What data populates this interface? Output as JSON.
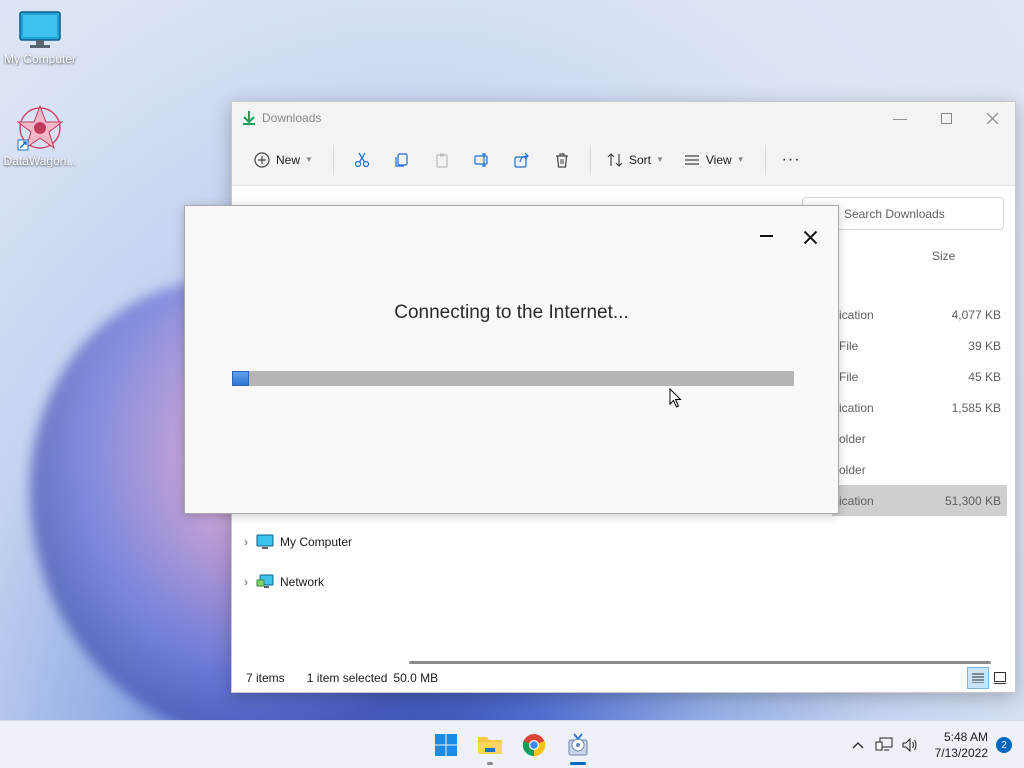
{
  "desktop": {
    "icons": [
      {
        "label": "My Computer"
      },
      {
        "label": "DataWagon..."
      }
    ]
  },
  "explorer": {
    "title": "Downloads",
    "toolbar": {
      "new_label": "New",
      "sort_label": "Sort",
      "view_label": "View",
      "more_label": "···"
    },
    "search_placeholder": "Search Downloads",
    "column_size": "Size",
    "rows": [
      {
        "type": "ication",
        "size": "4,077 KB"
      },
      {
        "type": "File",
        "size": "39 KB"
      },
      {
        "type": "File",
        "size": "45 KB"
      },
      {
        "type": "ication",
        "size": "1,585 KB"
      },
      {
        "type": "older",
        "size": ""
      },
      {
        "type": "older",
        "size": ""
      },
      {
        "type": "ication",
        "size": "51,300 KB"
      }
    ],
    "nav": [
      {
        "label": "My Computer"
      },
      {
        "label": "Network"
      }
    ],
    "status": {
      "items": "7 items",
      "selected": "1 item selected",
      "size": "50.0 MB"
    }
  },
  "dialog": {
    "message": "Connecting to the Internet...",
    "progress_fraction": 0.03
  },
  "taskbar": {
    "time": "5:48 AM",
    "date": "7/13/2022",
    "notifications": "2"
  },
  "colors": {
    "accent": "#0067c0",
    "progress_fill": "#2f76d6",
    "progress_track": "#b5b5b5"
  }
}
